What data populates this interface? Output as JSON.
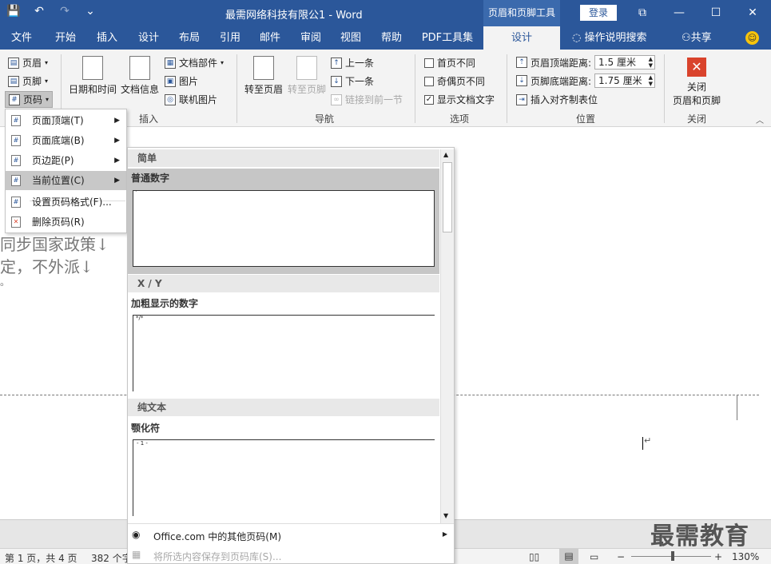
{
  "titlebar": {
    "doc_title": "最需网络科技有限公1  -  Word",
    "context_tools": "页眉和页脚工具",
    "login": "登录",
    "qat": {
      "save": "💾",
      "undo": "↶",
      "redo": "↷",
      "customize": "⌄"
    },
    "window": {
      "ribbon_opts": "⧉",
      "minimize": "—",
      "maximize": "☐",
      "close": "✕"
    }
  },
  "tabs": {
    "items": [
      "文件",
      "开始",
      "插入",
      "设计",
      "布局",
      "引用",
      "邮件",
      "审阅",
      "视图",
      "帮助",
      "PDF工具集",
      "设计"
    ],
    "tell_me": "操作说明搜索",
    "share": "共享"
  },
  "ribbon": {
    "header": "页眉",
    "footer": "页脚",
    "page_number": "页码",
    "date_time": "日期和时间",
    "doc_info": "文档信息",
    "doc_parts": "文档部件",
    "picture": "图片",
    "online_picture": "联机图片",
    "group_insert": "插入",
    "goto_header": "转至页眉",
    "goto_footer": "转至页脚",
    "prev": "上一条",
    "next": "下一条",
    "link_prev": "链接到前一节",
    "group_nav": "导航",
    "diff_first": "首页不同",
    "diff_odd_even": "奇偶页不同",
    "show_doc_text": "显示文档文字",
    "group_options": "选项",
    "header_top_label": "页眉顶端距离:",
    "header_top_value": "1.5 厘米",
    "footer_bottom_label": "页脚底端距离:",
    "footer_bottom_value": "1.75 厘米",
    "insert_align_tab": "插入对齐制表位",
    "group_position": "位置",
    "close_line1": "关闭",
    "close_line2": "页眉和页脚",
    "group_close": "关闭"
  },
  "menu": {
    "items": [
      {
        "label": "页面顶端(T)",
        "arrow": "▶"
      },
      {
        "label": "页面底端(B)",
        "arrow": "▶"
      },
      {
        "label": "页边距(P)",
        "arrow": "▶"
      },
      {
        "label": "当前位置(C)",
        "arrow": "▶"
      },
      {
        "label": "设置页码格式(F)...",
        "arrow": ""
      },
      {
        "label": "删除页码(R)",
        "arrow": ""
      }
    ]
  },
  "gallery": {
    "sec1": "简单",
    "item1": "普通数字",
    "sec2": "X / Y",
    "item2": "加粗显示的数字",
    "sec3": "纯文本",
    "item3": "颚化符",
    "thumb2_text": "*/*",
    "thumb3_text": "- 1 -",
    "more": "Office.com 中的其他页码(M)",
    "save_sel": "将所选内容保存到页码库(S)..."
  },
  "document": {
    "line1": "同步国家政策↓",
    "line2": "定，不外派↓",
    "line3": "。",
    "para_mark": "↵"
  },
  "status": {
    "page": "第 1 页，共 4 页",
    "words": "382 个字",
    "zoom": "130%",
    "zoom_minus": "−",
    "zoom_plus": "+"
  },
  "watermark": "最需教育"
}
